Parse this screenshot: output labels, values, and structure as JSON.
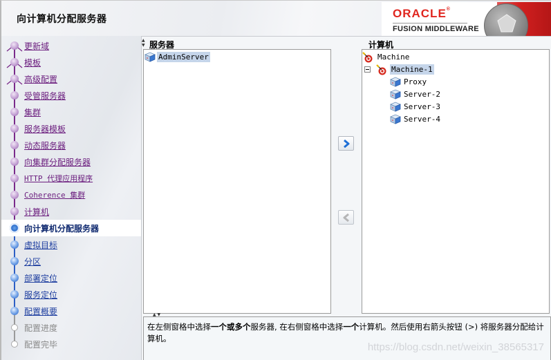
{
  "header": {
    "page_title": "向计算机分配服务器",
    "brand": {
      "oracle": "ORACLE",
      "registered": "®",
      "product": "FUSION MIDDLEWARE",
      "accent_color": "#e0261f"
    }
  },
  "sidebar": {
    "steps": [
      {
        "label": "更新域",
        "state": "done"
      },
      {
        "label": "模板",
        "state": "done"
      },
      {
        "label": "高级配置",
        "state": "done"
      },
      {
        "label": "受管服务器",
        "state": "done"
      },
      {
        "label": "集群",
        "state": "done"
      },
      {
        "label": "服务器模板",
        "state": "done"
      },
      {
        "label": "动态服务器",
        "state": "done"
      },
      {
        "label": "向集群分配服务器",
        "state": "done"
      },
      {
        "label": "HTTP 代理应用程序",
        "state": "done"
      },
      {
        "label": "Coherence 集群",
        "state": "done"
      },
      {
        "label": "计算机",
        "state": "done"
      },
      {
        "label": "向计算机分配服务器",
        "state": "current"
      },
      {
        "label": "虚拟目标",
        "state": "next"
      },
      {
        "label": "分区",
        "state": "next"
      },
      {
        "label": "部署定位",
        "state": "next"
      },
      {
        "label": "服务定位",
        "state": "next"
      },
      {
        "label": "配置概要",
        "state": "next"
      },
      {
        "label": "配置进度",
        "state": "disabled"
      },
      {
        "label": "配置完毕",
        "state": "disabled"
      }
    ]
  },
  "servers_pane": {
    "title": "服务器",
    "items": [
      {
        "label": "AdminServer",
        "icon": "server-icon",
        "selected": true
      }
    ]
  },
  "machines_pane": {
    "title": "计算机",
    "items": [
      {
        "label": "Machine",
        "icon": "machine-icon",
        "level": 0,
        "selected": false
      },
      {
        "label": "Machine-1",
        "icon": "machine-icon",
        "level": 0,
        "expanded": true,
        "selected": true,
        "children": [
          {
            "label": "Proxy",
            "icon": "server-icon"
          },
          {
            "label": "Server-2",
            "icon": "server-icon"
          },
          {
            "label": "Server-3",
            "icon": "server-icon"
          },
          {
            "label": "Server-4",
            "icon": "server-icon"
          }
        ]
      }
    ]
  },
  "buttons": {
    "assign": {
      "icon": "chevron-right-icon",
      "enabled": true
    },
    "unassign": {
      "icon": "chevron-left-icon",
      "enabled": false
    }
  },
  "help": {
    "p1": "在左侧窗格中选择",
    "b1": "一个或多个",
    "p2": "服务器, 在右侧窗格中选择",
    "b2": "一个",
    "p3": "计算机。然后使用右箭头按钮 (>) 将服务器分配给计算机。"
  },
  "watermark": "https://blog.csdn.net/weixin_38565317"
}
